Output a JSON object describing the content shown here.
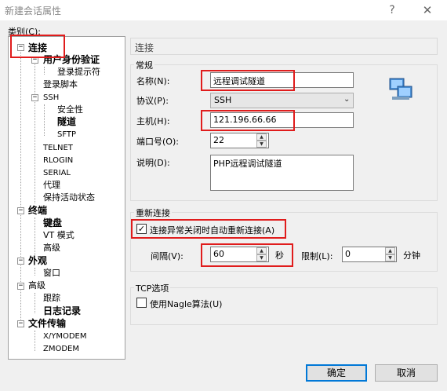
{
  "window": {
    "title": "新建会话属性",
    "help": "?",
    "close": "✕"
  },
  "category_label": "类别(C):",
  "tree": {
    "items": [
      {
        "label": "连接",
        "bold": true
      },
      {
        "label": "用户身份验证",
        "bold": true
      },
      {
        "label": "登录提示符",
        "bold": false
      },
      {
        "label": "登录脚本",
        "bold": false
      },
      {
        "label": "SSH",
        "bold": false
      },
      {
        "label": "安全性",
        "bold": false
      },
      {
        "label": "隧道",
        "bold": true
      },
      {
        "label": "SFTP",
        "bold": false
      },
      {
        "label": "TELNET",
        "bold": false
      },
      {
        "label": "RLOGIN",
        "bold": false
      },
      {
        "label": "SERIAL",
        "bold": false
      },
      {
        "label": "代理",
        "bold": false
      },
      {
        "label": "保持活动状态",
        "bold": false
      },
      {
        "label": "终端",
        "bold": true
      },
      {
        "label": "键盘",
        "bold": true
      },
      {
        "label": "VT 模式",
        "bold": false
      },
      {
        "label": "高级",
        "bold": false
      },
      {
        "label": "外观",
        "bold": true
      },
      {
        "label": "窗口",
        "bold": false
      },
      {
        "label": "高级",
        "bold": false
      },
      {
        "label": "跟踪",
        "bold": false
      },
      {
        "label": "日志记录",
        "bold": true
      },
      {
        "label": "文件传输",
        "bold": true
      },
      {
        "label": "X/YMODEM",
        "bold": false
      },
      {
        "label": "ZMODEM",
        "bold": false
      }
    ],
    "expander_minus": "−"
  },
  "section": {
    "title": "连接"
  },
  "general": {
    "group_title": "常规",
    "name_label": "名称(N):",
    "name_value": "远程调试隧道",
    "protocol_label": "协议(P):",
    "protocol_value": "SSH",
    "host_label": "主机(H):",
    "host_value": "121.196.66.66",
    "port_label": "端口号(O):",
    "port_value": "22",
    "desc_label": "说明(D):",
    "desc_value": "PHP远程调试隧道"
  },
  "reconnect": {
    "group_title": "重新连接",
    "checkbox_label": "连接异常关闭时自动重新连接(A)",
    "checked": true,
    "interval_label": "间隔(V):",
    "interval_value": "60",
    "interval_unit": "秒",
    "limit_label": "限制(L):",
    "limit_value": "0",
    "limit_unit": "分钟"
  },
  "tcp": {
    "group_title": "TCP选项",
    "nagle_label": "使用Nagle算法(U)",
    "nagle_checked": false
  },
  "buttons": {
    "ok": "确定",
    "cancel": "取消"
  },
  "colors": {
    "highlight": "#e01c1c",
    "accent": "#0078d7"
  }
}
